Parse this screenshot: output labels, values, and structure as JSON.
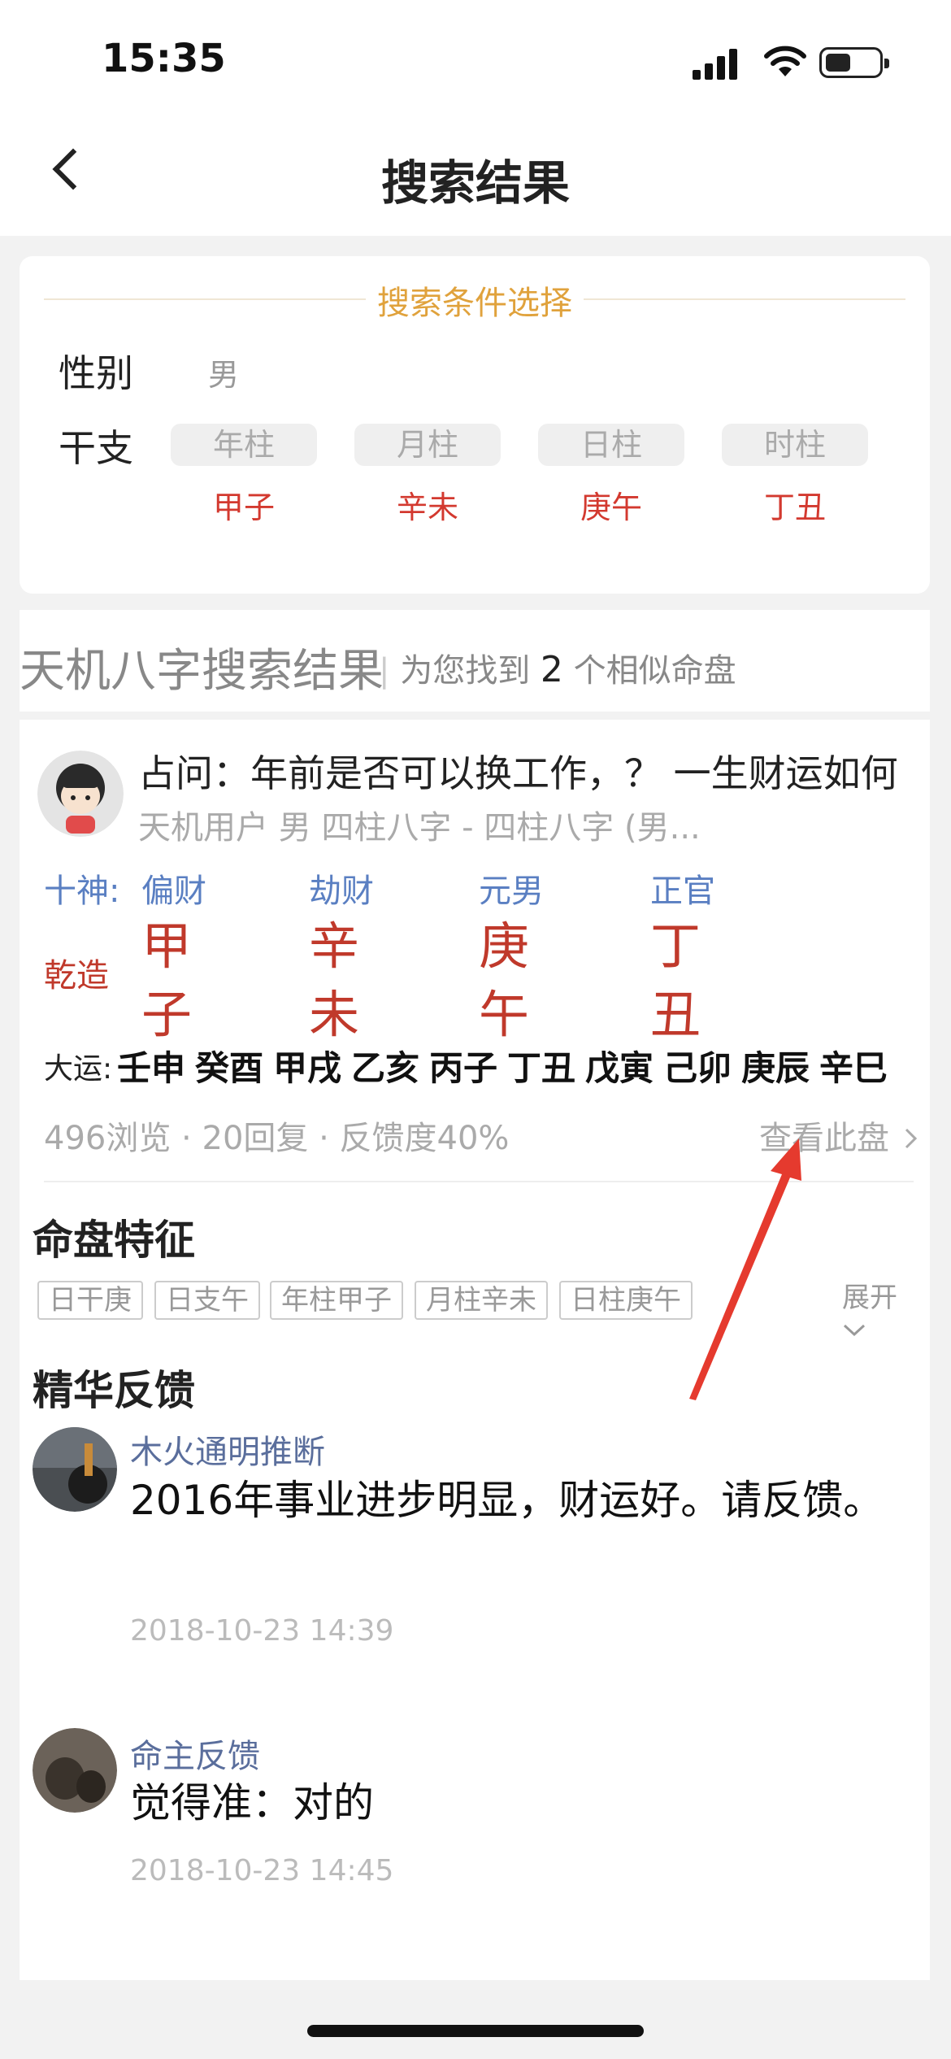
{
  "status_bar": {
    "time": "15:35"
  },
  "nav": {
    "title": "搜索结果"
  },
  "conditions": {
    "title": "搜索条件选择",
    "gender_label": "性别",
    "gender_value": "男",
    "ganzhi_label": "干支",
    "pillars": [
      {
        "label": "年柱",
        "value": "甲子"
      },
      {
        "label": "月柱",
        "value": "辛未"
      },
      {
        "label": "日柱",
        "value": "庚午"
      },
      {
        "label": "时柱",
        "value": "丁丑"
      }
    ]
  },
  "results": {
    "title": "天机八字搜索结果",
    "separator": "|",
    "prefix": "为您找到",
    "count": "2",
    "suffix": "个相似命盘"
  },
  "case": {
    "question": "占问：年前是否可以换工作，？ 一生财运如何",
    "meta": "天机用户 男 四柱八字 - 四柱八字 (男...",
    "shishen_label": "十神:",
    "shishen": [
      "偏财",
      "劫财",
      "元男",
      "正官"
    ],
    "qianzao_label": "乾造",
    "stems": [
      "甲",
      "辛",
      "庚",
      "丁"
    ],
    "branches": [
      "子",
      "未",
      "午",
      "丑"
    ],
    "dayun_label": "大运:",
    "dayun": [
      "壬申",
      "癸酉",
      "甲戌",
      "乙亥",
      "丙子",
      "丁丑",
      "戊寅",
      "己卯",
      "庚辰",
      "辛巳"
    ],
    "stats": "496浏览 · 20回复 · 反馈度40%",
    "view_link": "查看此盘"
  },
  "features": {
    "title": "命盘特征",
    "tags": [
      "日干庚",
      "日支午",
      "年柱甲子",
      "月柱辛未",
      "日柱庚午"
    ],
    "expand": "展开"
  },
  "feedback": {
    "title": "精华反馈",
    "items": [
      {
        "name": "木火通明推断",
        "text": "2016年事业进步明显，财运好。请反馈。",
        "time": "2018-10-23 14:39"
      },
      {
        "name": "命主反馈",
        "text": "觉得准：对的",
        "time": "2018-10-23 14:45"
      }
    ]
  },
  "colors": {
    "accent_gold": "#e0a23c",
    "ganzhi_red": "#c0392b",
    "shishen_blue": "#5a7fc2",
    "annotation_arrow": "#e53a2e"
  }
}
